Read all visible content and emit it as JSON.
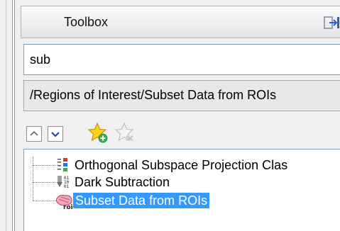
{
  "toolbox": {
    "title": "Toolbox",
    "search_value": "sub",
    "path": "/Regions of Interest/Subset Data from ROIs"
  },
  "toolbar": {
    "collapse_icon": "chevron-up-icon",
    "expand_icon": "chevron-down-icon",
    "add_favorite_icon": "star-add-icon",
    "remove_favorite_icon": "star-remove-icon"
  },
  "tree": {
    "items": [
      {
        "label": "Orthogonal Subspace Projection Clas",
        "icon": "classification-icon"
      },
      {
        "label": "Dark Subtraction",
        "icon": "binary-data-icon"
      },
      {
        "label": "Subset Data from ROIs",
        "icon": "roi-icon",
        "selected": true
      }
    ]
  },
  "colors": {
    "selection": "#3399ff",
    "panel_bg": "#f0f0f0",
    "border": "#7f9db9"
  }
}
